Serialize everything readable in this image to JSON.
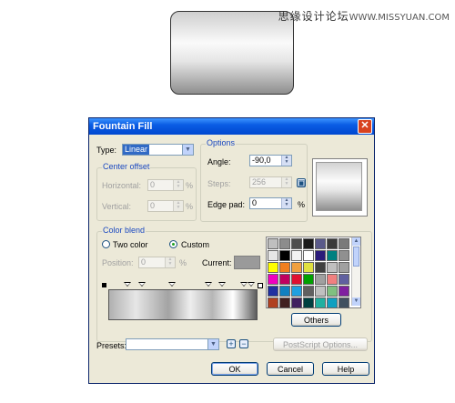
{
  "watermark": {
    "cn": "思缘设计论坛",
    "url": "WWW.MISSYUAN.COM"
  },
  "dialog": {
    "title": "Fountain Fill",
    "close_glyph": "✕",
    "type": {
      "label": "Type:",
      "value": "Linear"
    },
    "center_offset": {
      "title": "Center offset",
      "horizontal_label": "Horizontal:",
      "horizontal_value": "0",
      "horizontal_unit": "%",
      "vertical_label": "Vertical:",
      "vertical_value": "0",
      "vertical_unit": "%"
    },
    "options": {
      "title": "Options",
      "angle_label": "Angle:",
      "angle_value": "-90,0",
      "steps_label": "Steps:",
      "steps_value": "256",
      "edge_pad_label": "Edge pad:",
      "edge_pad_value": "0",
      "edge_pad_unit": "%"
    },
    "color_blend": {
      "title": "Color blend",
      "two_color_label": "Two color",
      "custom_label": "Custom",
      "selected": "Custom",
      "position_label": "Position:",
      "position_value": "0",
      "position_unit": "%",
      "current_label": "Current:",
      "current_color": "#9a9a9a",
      "others_label": "Others",
      "palette": [
        "#bfbfbf",
        "#8c8c8c",
        "#4d4d4d",
        "#1a1a1a",
        "#5a5a8a",
        "#3a3a3a",
        "#7a7a7a",
        "#e6e6e6",
        "#000000",
        "#f2f2f2",
        "#ffffff",
        "#2a1a7a",
        "#008080",
        "#909090",
        "#ffff00",
        "#f07f20",
        "#f0a040",
        "#e0e040",
        "#404040",
        "#c0c0c0",
        "#a0a0a0",
        "#f000c0",
        "#c00060",
        "#e01030",
        "#00a000",
        "#a0a0a0",
        "#f08080",
        "#6060a0",
        "#2030a0",
        "#1080c0",
        "#20a0e0",
        "#606060",
        "#c0c0c0",
        "#80c080",
        "#8020a0",
        "#b04020",
        "#402020",
        "#402060",
        "#004040",
        "#20b0a0",
        "#10a0c0",
        "#405060"
      ]
    },
    "presets": {
      "label": "Presets:",
      "value": ""
    },
    "postscript_label": "PostScript Options...",
    "ok_label": "OK",
    "cancel_label": "Cancel",
    "help_label": "Help"
  }
}
